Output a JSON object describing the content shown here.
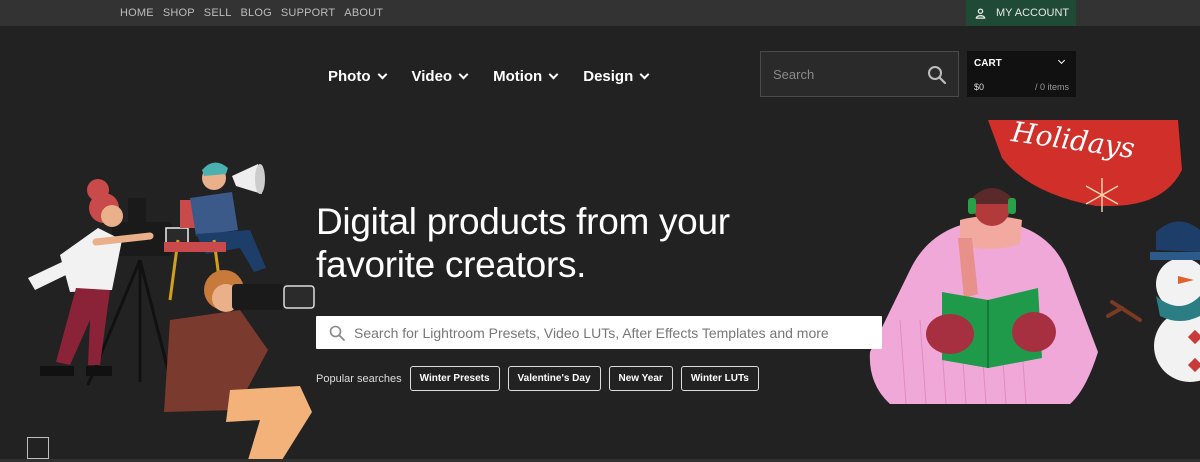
{
  "topnav": {
    "links": [
      "HOME",
      "SHOP",
      "SELL",
      "BLOG",
      "SUPPORT",
      "ABOUT"
    ],
    "account_label": "MY ACCOUNT"
  },
  "mainnav": {
    "items": [
      {
        "label": "Photo"
      },
      {
        "label": "Video"
      },
      {
        "label": "Motion"
      },
      {
        "label": "Design"
      }
    ]
  },
  "header_search": {
    "placeholder": "Search"
  },
  "cart": {
    "title": "CART",
    "amount": "$0",
    "items": "/ 0 items"
  },
  "hero": {
    "title_line1": "Digital products from your",
    "title_line2": "favorite creators.",
    "search_placeholder": "Search for Lightroom Presets, Video LUTs, After Effects Templates and more",
    "popular_label": "Popular searches",
    "chips": [
      "Winter Presets",
      "Valentine's Day",
      "New Year",
      "Winter LUTs"
    ]
  },
  "banner": {
    "holidays_text": "Holidays"
  },
  "colors": {
    "background": "#222222",
    "topbar": "#333333",
    "account_bg": "#1f4a36",
    "holiday_red": "#d12f2a",
    "sweater_pink": "#f0a8d8",
    "book_green": "#1f9a4a"
  },
  "icons": {
    "account": "user-icon",
    "search": "search-icon",
    "chevron": "chevron-down-icon"
  }
}
